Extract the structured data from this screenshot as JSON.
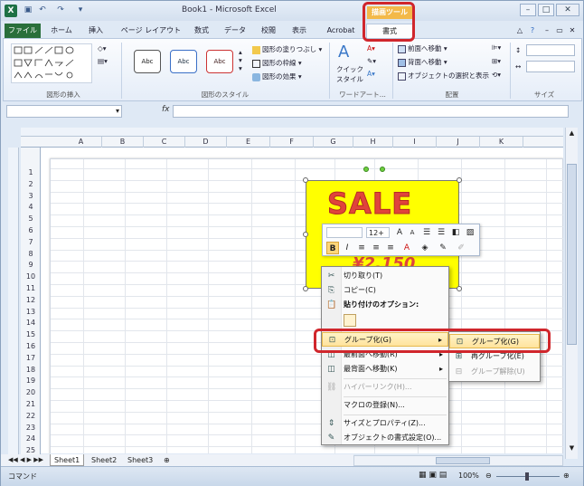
{
  "window": {
    "title": "Book1 - Microsoft Excel",
    "context_tab_group": "描画ツール"
  },
  "quick_access": [
    "save-icon",
    "undo-icon",
    "redo-icon"
  ],
  "tabs": [
    {
      "label": "ファイル"
    },
    {
      "label": "ホーム"
    },
    {
      "label": "挿入"
    },
    {
      "label": "ページ レイアウト"
    },
    {
      "label": "数式"
    },
    {
      "label": "データ"
    },
    {
      "label": "校閲"
    },
    {
      "label": "表示"
    },
    {
      "label": "Acrobat"
    },
    {
      "label": "書式"
    }
  ],
  "ribbon": {
    "groups": {
      "insert_shapes": "図形の挿入",
      "shape_styles": "図形のスタイル",
      "wordart": "ワードアート...",
      "arrange": "配置",
      "size": "サイズ"
    },
    "style_swatch": "Abc",
    "fill": "図形の塗りつぶし",
    "outline": "図形の枠線",
    "effects": "図形の効果",
    "quick_style": "クイック スタイル",
    "bring_front": "前面へ移動",
    "send_back": "背面へ移動",
    "selection_pane": "オブジェクトの選択と表示"
  },
  "formula_bar": {
    "fx": "fx",
    "value": ""
  },
  "columns": [
    "A",
    "B",
    "C",
    "D",
    "E",
    "F",
    "G",
    "H",
    "I",
    "J",
    "K"
  ],
  "rows": [
    "1",
    "2",
    "3",
    "4",
    "5",
    "6",
    "7",
    "8",
    "9",
    "10",
    "11",
    "12",
    "13",
    "14",
    "15",
    "16",
    "17",
    "18",
    "19",
    "20",
    "21",
    "22",
    "23",
    "24",
    "25"
  ],
  "graphic": {
    "headline": "SALE",
    "price": "¥2,150"
  },
  "minitoolbar": {
    "font_size": "12+",
    "bold": "B",
    "italic": "I"
  },
  "context_menu": {
    "items": [
      {
        "label": "切り取り(T)",
        "icon": "scissors-icon",
        "disabled": false
      },
      {
        "label": "コピー(C)",
        "icon": "copy-icon",
        "disabled": false
      },
      {
        "label": "貼り付けのオプション:",
        "icon": "paste-icon",
        "disabled": false
      },
      {
        "label": "グループ化(G)",
        "icon": "group-icon",
        "disabled": false,
        "submenu": true
      },
      {
        "label": "最前面へ移動(R)",
        "icon": "bring-front-icon",
        "disabled": false,
        "submenu": true
      },
      {
        "label": "最背面へ移動(K)",
        "icon": "send-back-icon",
        "disabled": false,
        "submenu": true
      },
      {
        "label": "ハイパーリンク(H)...",
        "icon": "link-icon",
        "disabled": true
      },
      {
        "label": "マクロの登録(N)...",
        "icon": "",
        "disabled": false
      },
      {
        "label": "サイズとプロパティ(Z)...",
        "icon": "size-icon",
        "disabled": false
      },
      {
        "label": "オブジェクトの書式設定(O)...",
        "icon": "format-icon",
        "disabled": false
      }
    ],
    "submenu": [
      {
        "label": "グループ化(G)",
        "disabled": false
      },
      {
        "label": "再グループ化(E)",
        "disabled": false
      },
      {
        "label": "グループ解除(U)",
        "disabled": true
      }
    ]
  },
  "sheet_tabs": [
    "Sheet1",
    "Sheet2",
    "Sheet3"
  ],
  "status": {
    "mode": "コマンド",
    "zoom": "100%"
  }
}
